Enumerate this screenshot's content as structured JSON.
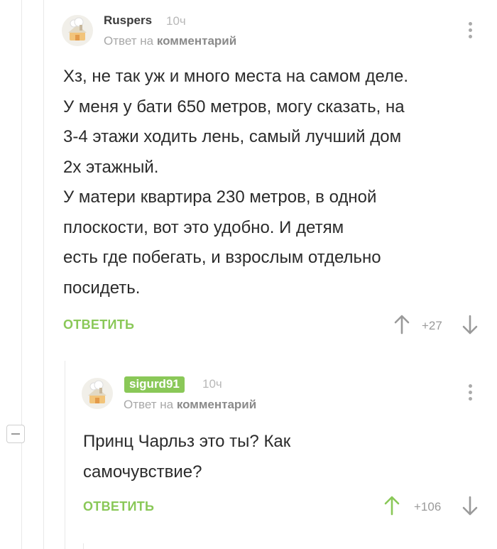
{
  "comments": [
    {
      "username": "Ruspers",
      "time": "10ч",
      "reply_prefix": "Ответ на",
      "reply_target": "комментарий",
      "text_lines": [
        "Хз, не так уж и много места на самом деле.",
        "У меня у бати 650 метров, могу сказать, на",
        "3-4 этажи ходить лень, самый лучший дом",
        "2х этажный.",
        "У матери квартира 230 метров, в одной",
        "плоскости, вот это удобно. И детям",
        "есть где побегать, и взрослым отдельно",
        "посидеть."
      ],
      "reply_label": "ОТВЕТИТЬ",
      "rating": "+27"
    },
    {
      "username": "sigurd91",
      "time": "10ч",
      "reply_prefix": "Ответ на",
      "reply_target": "комментарий",
      "text_lines": [
        "Принц Чарльз это ты? Как",
        "самочувствие?"
      ],
      "reply_label": "ОТВЕТИТЬ",
      "rating": "+106"
    }
  ],
  "colors": {
    "accent_green": "#8ac858",
    "upvote_active": "#8ac858",
    "vote_inactive": "#9a9a9a"
  },
  "icons": [
    "avatar-placeholder-icon",
    "more-options-icon",
    "upvote-arrow-icon",
    "downvote-arrow-icon",
    "collapse-thread-icon"
  ]
}
